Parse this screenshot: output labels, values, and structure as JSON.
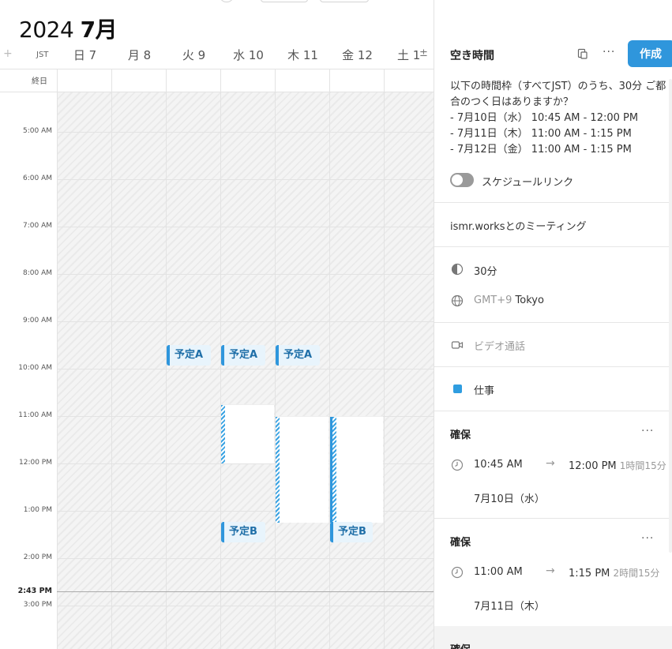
{
  "calendar": {
    "year": "2024",
    "month": "7月",
    "add_symbol": "+",
    "timezone": "JST",
    "all_day": "終日",
    "days": [
      "日 7",
      "月 8",
      "火 9",
      "水 10",
      "木 11",
      "金 12",
      "土 1"
    ],
    "day_extra": "±",
    "hours": [
      "5:00 AM",
      "6:00 AM",
      "7:00 AM",
      "8:00 AM",
      "9:00 AM",
      "10:00 AM",
      "11:00 AM",
      "12:00 PM",
      "1:00 PM",
      "2:00 PM",
      "3:00 PM"
    ],
    "now_time": "2:43 PM",
    "events": {
      "a": "予定A",
      "b": "予定B"
    }
  },
  "panel": {
    "title": "空き時間",
    "create_label": "作成",
    "message": {
      "line1": "以下の時間枠（すべてJST）のうち、30分 ご都",
      "line2": "合のつく日はありますか？",
      "line3": "- 7月10日（水） 10:45 AM - 12:00 PM",
      "line4": "- 7月11日（木） 11:00 AM - 1:15 PM",
      "line5": "- 7月12日（金） 11:00 AM - 1:15 PM"
    },
    "schedule_link_label": "スケジュールリンク",
    "meeting_title": "ismr.worksとのミーティング",
    "duration": "30分",
    "timezone_offset": "GMT+9",
    "timezone_city": "Tokyo",
    "video_call": "ビデオ通話",
    "calendar_name": "仕事",
    "reservations": [
      {
        "title": "確保",
        "start": "10:45 AM",
        "arrow": "→",
        "end": "12:00 PM",
        "duration": "1時間15分",
        "date": "7月10日（水）"
      },
      {
        "title": "確保",
        "start": "11:00 AM",
        "arrow": "→",
        "end": "1:15 PM",
        "duration": "2時間15分",
        "date": "7月11日（木）"
      },
      {
        "title": "確保"
      }
    ],
    "more": "···"
  },
  "colors": {
    "accent": "#2f96dc",
    "event_bg": "#e8f4fc",
    "work": "#2f9de0"
  }
}
